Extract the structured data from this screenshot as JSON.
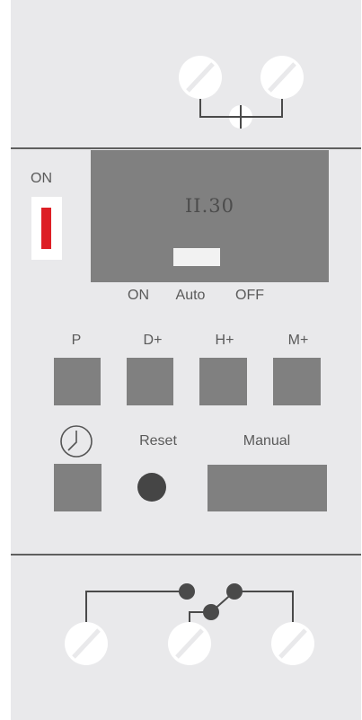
{
  "switch": {
    "label": "ON",
    "accent_color": "#dd1f26"
  },
  "display": {
    "time": "II.30"
  },
  "mode_labels": {
    "on": "ON",
    "auto": "Auto",
    "off": "OFF"
  },
  "buttons": {
    "p": "P",
    "d_plus": "D+",
    "h_plus": "H+",
    "m_plus": "M+",
    "reset": "Reset",
    "manual": "Manual"
  },
  "icons": {
    "clock": "clock-icon",
    "terminal": "terminal-screw-icon",
    "diagram": "relay-switch-diagram"
  },
  "colors": {
    "panel": "#e9e9eb",
    "control": "#808080",
    "lines": "#5f5f5f",
    "switch": "#dd1f26"
  }
}
